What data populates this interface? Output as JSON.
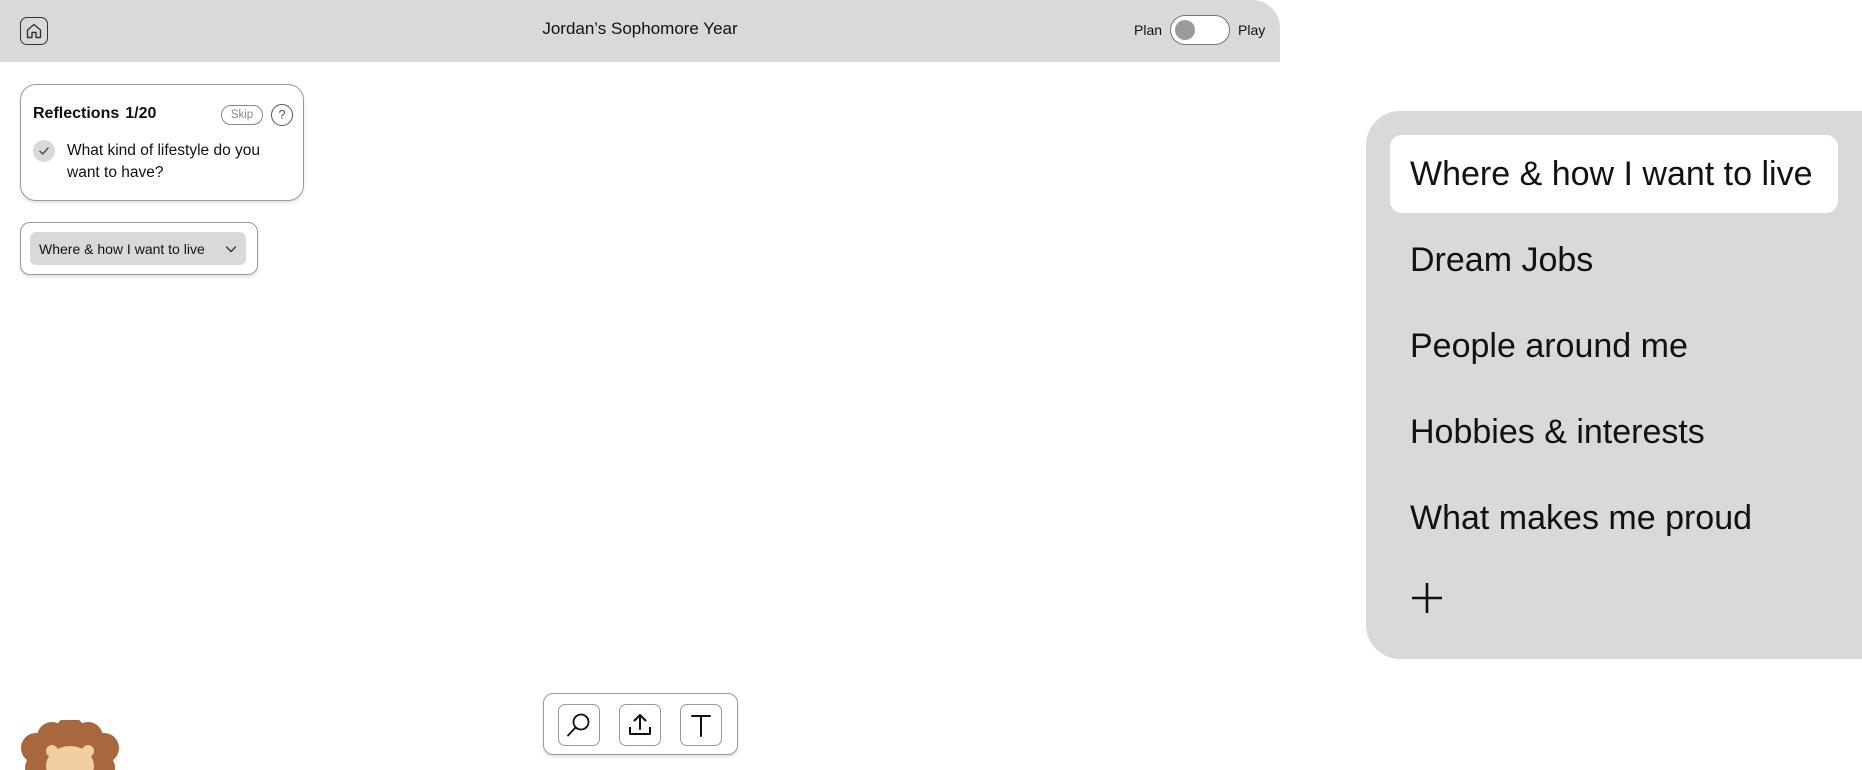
{
  "header": {
    "title": "Jordan’s Sophomore Year",
    "mode_left_label": "Plan",
    "mode_right_label": "Play",
    "mode_state": "Plan",
    "home_icon": "home-icon"
  },
  "reflections": {
    "label": "Reflections",
    "count": "1/20",
    "skip_label": "Skip",
    "help_label": "?",
    "question": "What kind of lifestyle do you want to have?"
  },
  "category_select": {
    "value": "Where & how I want to live"
  },
  "category_panel": {
    "items": [
      {
        "label": "Where & how I want to live",
        "active": true
      },
      {
        "label": "Dream Jobs",
        "active": false
      },
      {
        "label": "People around me",
        "active": false
      },
      {
        "label": "Hobbies & interests",
        "active": false
      },
      {
        "label": "What makes me proud",
        "active": false
      }
    ],
    "add_icon": "plus-icon"
  },
  "toolbar": {
    "tools": [
      "search-icon",
      "upload-icon",
      "text-tool-icon"
    ]
  },
  "colors": {
    "panel_bg": "#d9d9d9",
    "active_item_bg": "#ffffff",
    "toggle_knob": "#9b9b9b",
    "avatar_brown": "#a8673d",
    "avatar_face": "#f2cfa0"
  }
}
